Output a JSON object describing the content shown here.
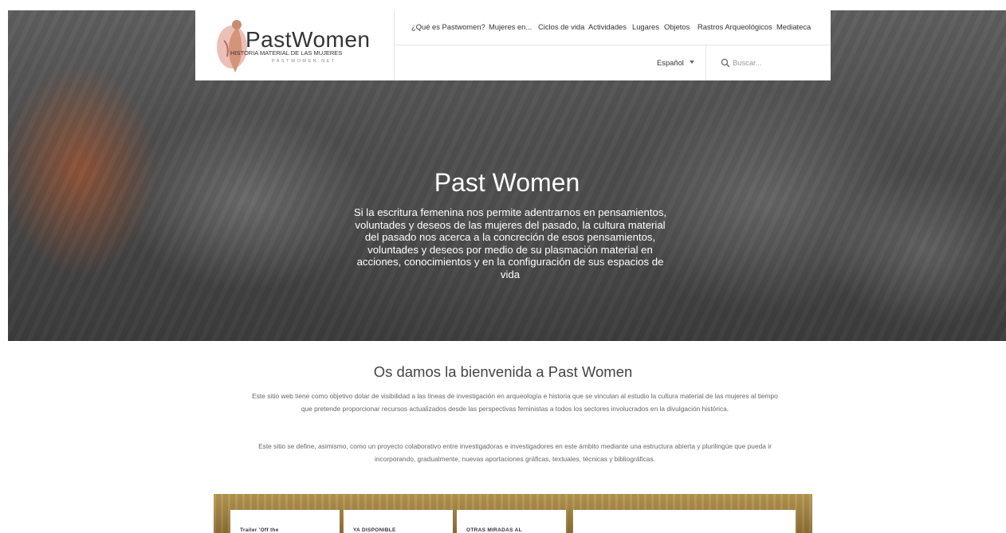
{
  "header": {
    "logo": {
      "name": "PastWomen",
      "subtitle": "HISTORIA MATERIAL DE LAS MUJERES",
      "url": "PASTWOMEN.NET"
    },
    "nav": [
      "¿Qué es Pastwomen?",
      "Mujeres en...",
      "Ciclos de vida",
      "Actividades",
      "Lugares",
      "Objetos",
      "Rastros Arqueológicos",
      "Mediateca"
    ],
    "language": "Español",
    "search_placeholder": "Buscar..."
  },
  "hero": {
    "title": "Past Women",
    "text": "Si la escritura femenina nos permite adentrarnos en pensamientos, voluntades y deseos de las mujeres del pasado, la cultura material del pasado nos acerca a la concreción de esos pensamientos, voluntades y deseos por medio de su plasmación material en acciones, conocimientos y en la configuración de sus espacios de vida"
  },
  "welcome": {
    "title": "Os damos la bienvenida a Past Women",
    "p1": "Este sitio web tiene como objetivo dotar de visibilidad a las líneas de investigación en arqueología e historia que se vinculan al estudio la cultura material de las mujeres al tiempo que pretende proporcionar recursos actualizados desde las perspectivas feministas a todos los sectores involucrados en la divulgación histórica.",
    "p2": "Este sitio se define, asimismo, como un proyecto colaborativo entre investigadoras e investigadores en este ámbito mediante una estructura abierta y plurilingüe que pueda ir incorporando, gradualmente, nuevas aportaciones gráficas, textuales, técnicas y bibliográficas."
  },
  "cards": [
    {
      "label": "Trailer 'Off the"
    },
    {
      "label": "YA DISPONIBLE"
    },
    {
      "label": "OTRAS MIRADAS AL"
    },
    {
      "label": ""
    }
  ],
  "colors": {
    "logo_accent": "#e6a9a0",
    "hero_overlay": "#4b4b4b",
    "banner": "#a38446"
  }
}
